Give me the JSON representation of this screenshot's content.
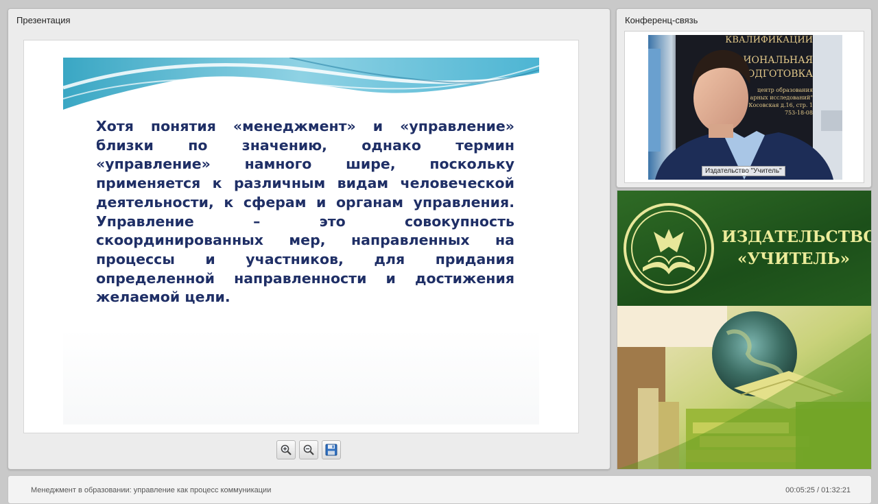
{
  "presentation": {
    "title": "Презентация",
    "slide_text": "Хотя понятия «менеджмент» и «управление» близки по значению, однако термин «управление» намного шире, поскольку применяется к различным видам человеческой деятельности, к сферам и органам управления. Управление – это совокупность скоординированных мер, направленных на процессы и участников, для придания определенной направленности и достижения желаемой цели.",
    "toolbar": [
      {
        "name": "zoom-in",
        "icon": "zoom-in-icon"
      },
      {
        "name": "zoom-out",
        "icon": "zoom-out-icon"
      },
      {
        "name": "save",
        "icon": "save-icon"
      }
    ]
  },
  "conference": {
    "title": "Конференц-связь",
    "video_caption": "Издательство \"Учитель\"",
    "background_sign_lines": [
      "КВАЛИФИКАЦИИ",
      "ИОНАЛЬНАЯ",
      "ОДГОТОВКА",
      "центр образования",
      "арных исследований\"",
      "Косовская д.16, стр. 1",
      "753-18-08"
    ]
  },
  "publisher": {
    "name_line1": "ИЗДАТЕЛЬСТВО",
    "name_line2": "«УЧИТЕЛЬ»",
    "brand_green": "#1f5a1c",
    "brand_text_color": "#ecec9a"
  },
  "status_bar": {
    "course_title": "Менеджмент в образовании: управление как процесс коммуникации",
    "time_elapsed": "00:05:25",
    "time_separator": " / ",
    "time_total": "01:32:21"
  }
}
